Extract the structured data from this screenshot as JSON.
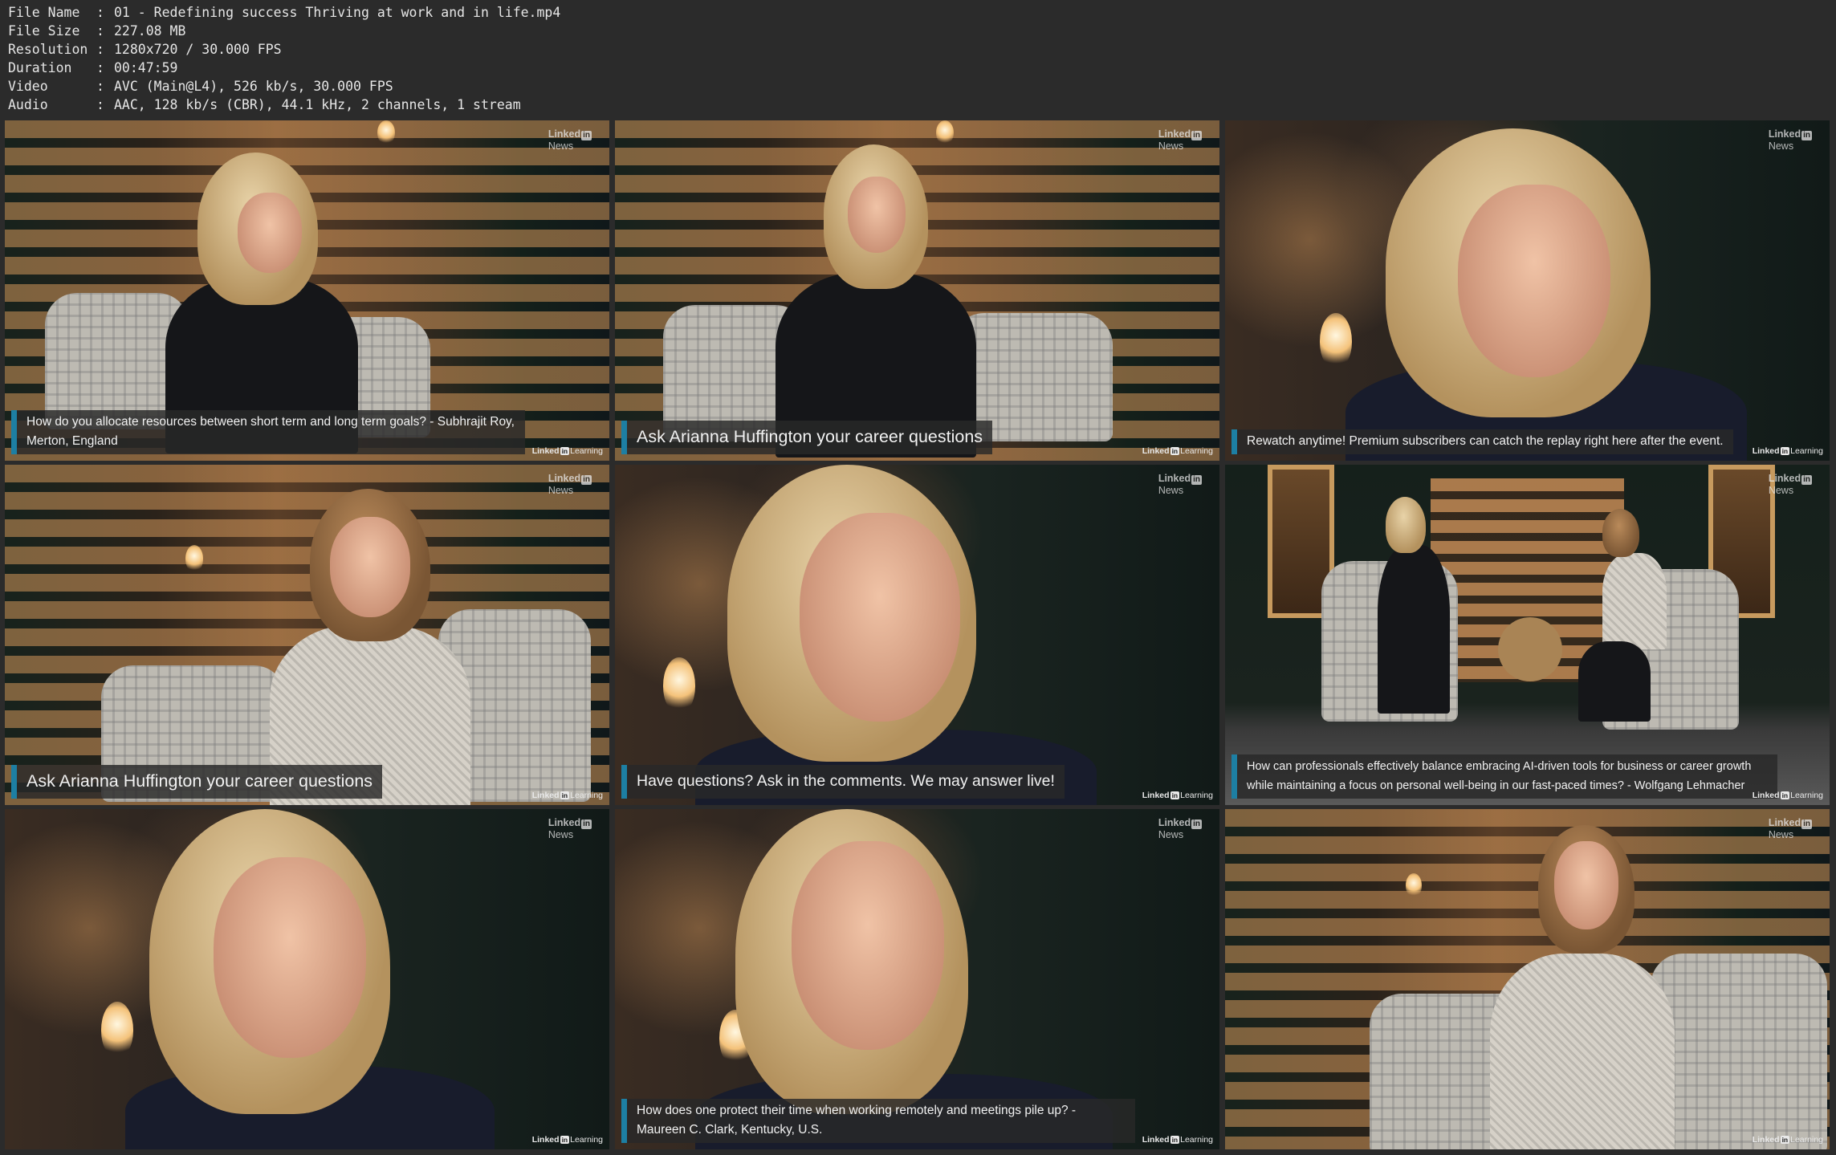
{
  "info": [
    {
      "key": "File Name",
      "value": "01 - Redefining success Thriving at work and in life.mp4"
    },
    {
      "key": "File Size",
      "value": "227.08 MB"
    },
    {
      "key": "Resolution",
      "value": "1280x720 / 30.000 FPS"
    },
    {
      "key": "Duration",
      "value": "00:47:59"
    },
    {
      "key": "Video",
      "value": "AVC (Main@L4), 526 kb/s, 30.000 FPS"
    },
    {
      "key": "Audio",
      "value": "AAC, 128 kb/s (CBR), 44.1 kHz, 2 channels, 1 stream"
    }
  ],
  "separator": ":",
  "logo": {
    "news_top": "Linked",
    "news_in": "in",
    "news_bottom": "News",
    "learning_left": "Linked",
    "learning_in": "in",
    "learning_right": "Learning"
  },
  "thumbnails": [
    {
      "caption": "How do you allocate resources between short term and long term goals? - Subhrajit Roy, Merton, England"
    },
    {
      "caption": "Ask Arianna Huffington your career questions"
    },
    {
      "caption": "Rewatch anytime! Premium subscribers can catch the replay right here after the event."
    },
    {
      "caption": "Ask Arianna Huffington your career questions"
    },
    {
      "caption": "Have questions? Ask in the comments. We may answer live!"
    },
    {
      "caption": "How can professionals effectively balance embracing AI-driven tools for business or career growth while maintaining a focus on personal well-being in our fast-paced times? - Wolfgang Lehmacher"
    },
    {
      "caption": ""
    },
    {
      "caption": "How does one protect their time when working remotely and meetings pile up? - Maureen C. Clark, Kentucky, U.S."
    },
    {
      "caption": ""
    }
  ]
}
